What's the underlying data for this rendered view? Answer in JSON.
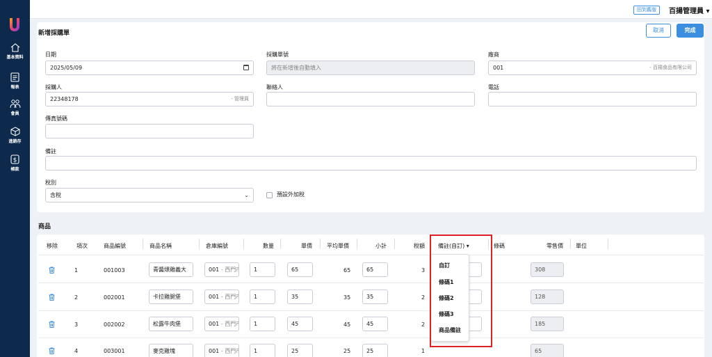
{
  "sidebar": {
    "items": [
      {
        "label": "基本資料",
        "icon": "home-icon"
      },
      {
        "label": "報表",
        "icon": "report-icon"
      },
      {
        "label": "會員",
        "icon": "members-icon"
      },
      {
        "label": "進銷存",
        "icon": "inventory-box-icon"
      },
      {
        "label": "帳款",
        "icon": "dollar-icon"
      }
    ]
  },
  "topbar": {
    "old_version": "回到舊版",
    "user": "百揚管理員 ▾"
  },
  "form": {
    "title": "新增採購單",
    "cancel": "取消",
    "done": "完成",
    "date_label": "日期",
    "date_value": "2025/05/09",
    "order_no_label": "採購單號",
    "order_no_placeholder": "將在新增後自動填入",
    "vendor_label": "廠商",
    "vendor_value": "001",
    "vendor_name": "- 百揚食品有限公司",
    "buyer_label": "採購人",
    "buyer_value": "22348178",
    "buyer_role": "- 管理員",
    "contact_label": "聯絡人",
    "phone_label": "電話",
    "fax_label": "傳真號碼",
    "note_label": "備註",
    "tax_label": "稅別",
    "tax_value": "含稅",
    "tax_default_label": "預設外加稅"
  },
  "products": {
    "title": "商品",
    "headers": [
      "移除",
      "項次",
      "商品編號",
      "商品名稱",
      "倉庫編號",
      "數量",
      "單價",
      "平均單價",
      "小計",
      "稅額",
      "備註(自訂) ▾",
      "條碼",
      "零售價",
      "單位"
    ],
    "rows": [
      {
        "no": "1",
        "code": "001003",
        "name": "青醬燻雞義大",
        "wh": "001",
        "wh_name": "- 西門市",
        "qty": "1",
        "price": "65",
        "avg": "65",
        "subtotal": "65",
        "tax": "3",
        "retail": "308"
      },
      {
        "no": "2",
        "code": "002001",
        "name": "卡拉雞腿堡",
        "wh": "001",
        "wh_name": "- 西門市",
        "qty": "1",
        "price": "35",
        "avg": "35",
        "subtotal": "35",
        "tax": "2",
        "retail": "128"
      },
      {
        "no": "3",
        "code": "002002",
        "name": "松露牛肉堡",
        "wh": "001",
        "wh_name": "- 西門市",
        "qty": "1",
        "price": "45",
        "avg": "45",
        "subtotal": "45",
        "tax": "2",
        "retail": "185"
      },
      {
        "no": "4",
        "code": "003001",
        "name": "麥克雞塊",
        "wh": "001",
        "wh_name": "- 西門市",
        "qty": "1",
        "price": "25",
        "avg": "25",
        "subtotal": "25",
        "tax": "1",
        "retail": "65"
      }
    ]
  },
  "dropdown": {
    "options": [
      "自訂",
      "條碼1",
      "條碼2",
      "條碼3",
      "商品備註"
    ]
  },
  "colors": {
    "accent": "#3b8ee0",
    "sidebar": "#0d2a4d",
    "highlight": "#e02020"
  }
}
